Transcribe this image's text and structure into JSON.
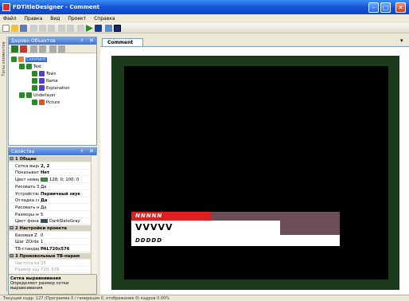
{
  "window": {
    "title": "FDTitleDesigner - Comment",
    "min": "–",
    "max": "□",
    "close": "✕"
  },
  "menu": [
    "Файл",
    "Правка",
    "Вид",
    "Проект",
    "Справка"
  ],
  "sidetab": {
    "label": "Типы элементов"
  },
  "tree_panel": {
    "title": "Дерево Объектов",
    "pin": "♯",
    "close": "✕",
    "nodes": [
      "Comment",
      "Text",
      "Town",
      "Name",
      "Explanation",
      "Underlayer",
      "Picture"
    ]
  },
  "props_panel": {
    "title": "Свойства",
    "pin": "♯",
    "close": "✕",
    "rows": [
      {
        "type": "cat",
        "name": "1 Общие"
      },
      {
        "type": "row",
        "name": "Сетка вырав",
        "value": "2, 2",
        "bold": true
      },
      {
        "type": "row",
        "name": "Показывать",
        "value": "Нет",
        "bold": true
      },
      {
        "type": "row",
        "name": "Цвет невиди",
        "value": "128; 0; 100; 0",
        "swatch": "#4a8a4a"
      },
      {
        "type": "row",
        "name": "Рисовать Эл",
        "value": "Да"
      },
      {
        "type": "row",
        "name": "Устройство I",
        "value": "Первичный звук",
        "bold": true
      },
      {
        "type": "row",
        "name": "Отладка скр",
        "value": "Да",
        "bold": true
      },
      {
        "type": "row",
        "name": "Рисовать не",
        "value": "Да"
      },
      {
        "type": "row",
        "name": "Размеры не",
        "value": "5"
      },
      {
        "type": "row",
        "name": "Цвет фона",
        "value": "DarkSlateGray",
        "swatch": "#2f4f4f"
      },
      {
        "type": "cat",
        "name": "2 Настройки проекта"
      },
      {
        "type": "row",
        "name": "Базовая Z ко",
        "value": "0"
      },
      {
        "type": "row",
        "name": "Шаг ZOrder",
        "value": "1"
      },
      {
        "type": "row",
        "name": "ТВ-стандарт",
        "value": "PAL720x576",
        "bold": true
      },
      {
        "type": "cat",
        "name": "3 Произвольные ТВ-парам"
      },
      {
        "type": "row",
        "name": "Частота кад",
        "value": "25",
        "muted": true
      },
      {
        "type": "row",
        "name": "Размер кадр",
        "value": "720, 576",
        "muted": true
      }
    ],
    "desc_title": "Сетка выравнивания",
    "desc_text": "Определяет размер сетки выравнивания"
  },
  "doc": {
    "tab": "Comment",
    "arrow": "▾"
  },
  "lower_third": {
    "town": "NNNNN",
    "name": "VVVVV",
    "explanation": "DDDDD"
  },
  "status": "Текущий кадр: 127 (Программа 0 / генерация 0, отображение 0) кадров   0.00%"
}
